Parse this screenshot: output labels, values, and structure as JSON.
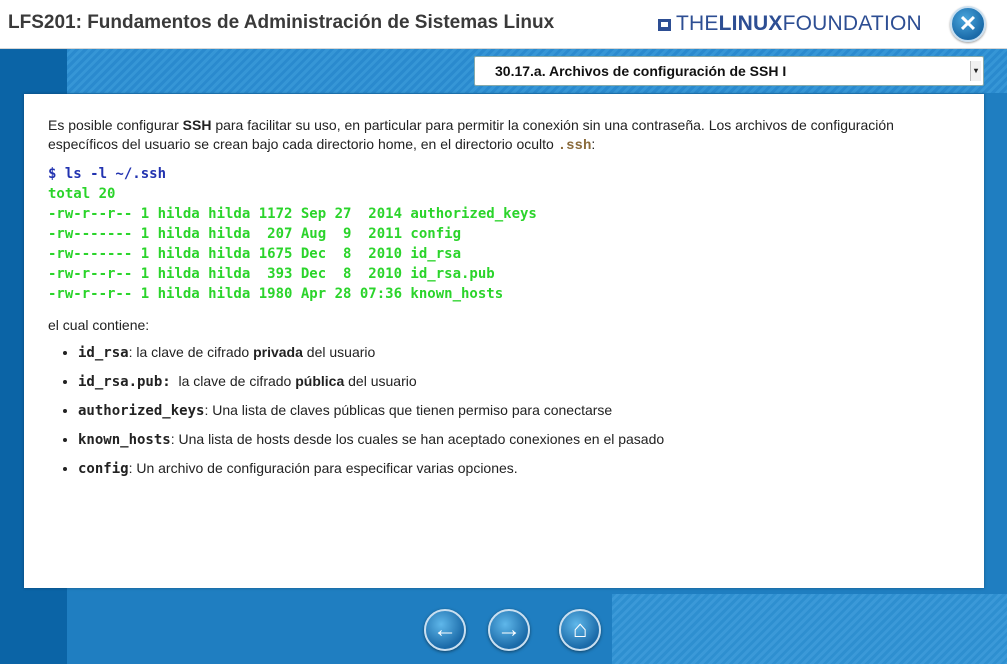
{
  "header": {
    "title": "LFS201: Fundamentos de Administración de Sistemas Linux",
    "brand_the": "THE",
    "brand_linux": "LINUX",
    "brand_foundation": "FOUNDATION",
    "close_glyph": "✕"
  },
  "section": {
    "selected": "30.17.a. Archivos de configuración de SSH I",
    "arrow_glyph": "▾"
  },
  "content": {
    "intro_1": "Es posible configurar ",
    "intro_ssh": "SSH",
    "intro_2": " para facilitar su uso, en particular para permitir la conexión sin una contraseña. Los archivos de configuración específicos del usuario se crean bajo cada directorio home, en el directorio oculto ",
    "intro_dir": ".ssh",
    "intro_3": ":",
    "terminal": {
      "prompt": "$ ls -l ~/.ssh",
      "lines": [
        "total 20",
        "-rw-r--r-- 1 hilda hilda 1172 Sep 27  2014 authorized_keys",
        "-rw------- 1 hilda hilda  207 Aug  9  2011 config",
        "-rw------- 1 hilda hilda 1675 Dec  8  2010 id_rsa",
        "-rw-r--r-- 1 hilda hilda  393 Dec  8  2010 id_rsa.pub",
        "-rw-r--r-- 1 hilda hilda 1980 Apr 28 07:36 known_hosts"
      ]
    },
    "contains_label": "el cual contiene:",
    "bullets": [
      {
        "term": "id_rsa",
        "pre": ": la clave de cifrado ",
        "bold": "privada",
        "post": " del usuario"
      },
      {
        "term": "id_rsa.pub:",
        "pre": "  la clave de cifrado ",
        "bold": "pública",
        "post": " del usuario"
      },
      {
        "term": "authorized_keys",
        "pre": ": Una lista de claves públicas que tienen permiso para conectarse",
        "bold": "",
        "post": ""
      },
      {
        "term": "known_hosts",
        "pre": ": Una lista de hosts desde los cuales se han aceptado conexiones en el pasado",
        "bold": "",
        "post": ""
      },
      {
        "term": "config",
        "pre": ": Un archivo de configuración para especificar varias opciones.",
        "bold": "",
        "post": ""
      }
    ]
  },
  "nav": {
    "back_glyph": "←",
    "forward_glyph": "→",
    "home_glyph": "⌂"
  },
  "colors": {
    "accent_blue": "#1f7ec1",
    "brand_blue": "#2d4e93",
    "terminal_green": "#2bd42b",
    "prompt_blue": "#2233b0"
  },
  "icons": [
    "close-icon",
    "back-arrow-icon",
    "forward-arrow-icon",
    "home-icon",
    "dropdown-arrow-icon"
  ]
}
